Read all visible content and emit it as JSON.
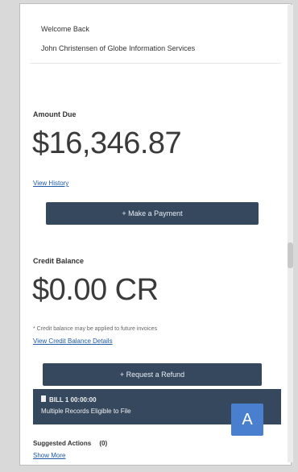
{
  "welcome": {
    "title": "Welcome Back",
    "subtitle": "John Christensen of Globe Information Services"
  },
  "amount_due": {
    "label": "Amount Due",
    "value": "$16,346.87",
    "link": "View History",
    "button": "+ Make a Payment"
  },
  "credit_balance": {
    "label": "Credit Balance",
    "value": "$0.00 CR",
    "note": "* Credit balance may be applied to future invoices",
    "link": "View Credit Balance Details",
    "button": "+ Request a Refund"
  },
  "toast": {
    "icon": "document-icon",
    "title": "BILL 1 00:00:00",
    "message": "Multiple Records Eligible to File"
  },
  "avatar": {
    "letter": "A",
    "color": "#4a7fd0"
  },
  "suggested": {
    "label": "Suggested Actions",
    "count": "(0)",
    "link": "Show More"
  },
  "colors": {
    "button_bg": "#36485e",
    "link": "#1f5aa6",
    "avatar_bg": "#4a7fd0"
  }
}
